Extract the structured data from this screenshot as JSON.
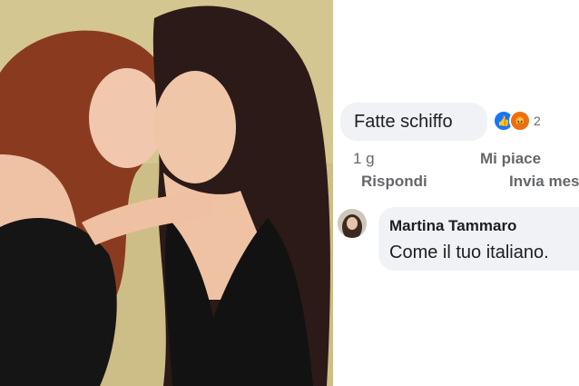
{
  "comments": [
    {
      "text": "Fatte schiffo",
      "reactions": {
        "icons": [
          "like-icon",
          "angry-icon"
        ],
        "count": "2"
      },
      "time": "1 g",
      "like_label": "Mi piace",
      "reply_label": "Rispondi",
      "message_label": "Invia mes"
    },
    {
      "author": "Martina Tammaro",
      "text": "Come il tuo italiano."
    }
  ],
  "colors": {
    "bubble": "#f0f2f5",
    "meta_text": "#65676b",
    "like_blue": "#1877f2",
    "angry_orange": "#e9710f"
  }
}
